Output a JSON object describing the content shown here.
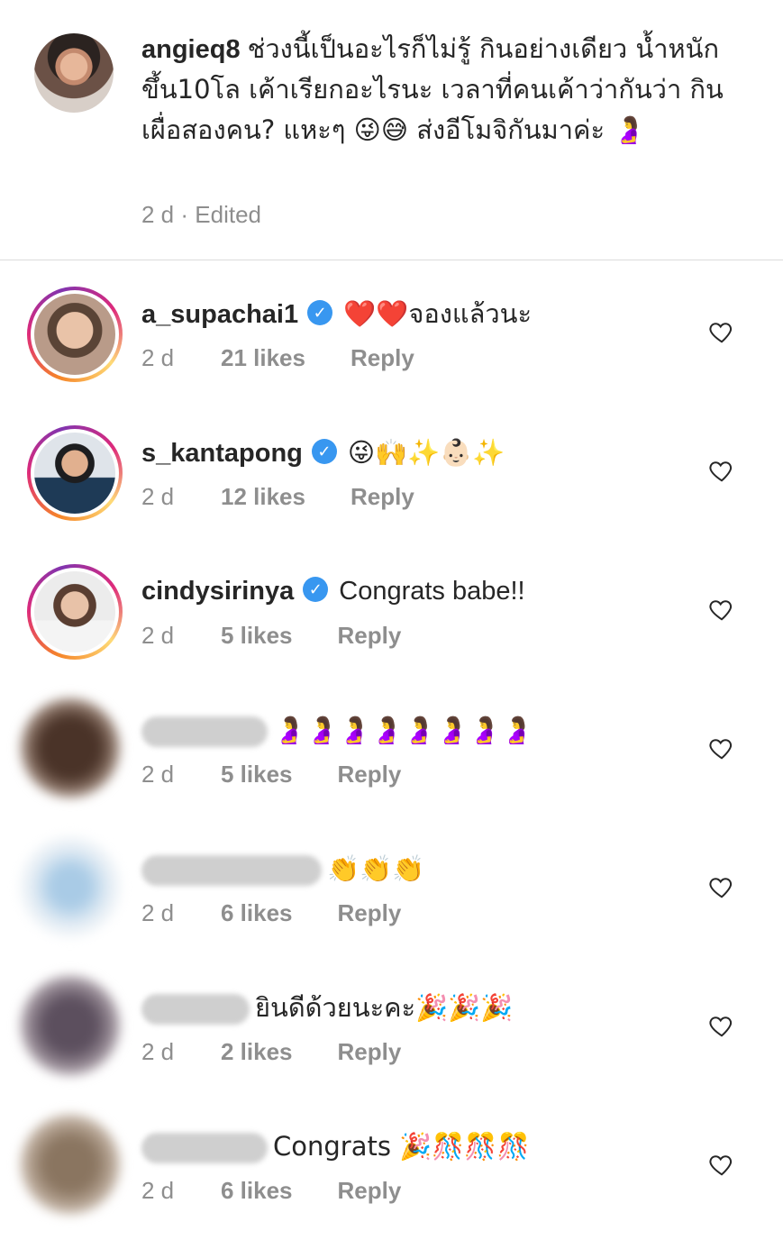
{
  "caption": {
    "username": "angieq8",
    "text": "ช่วงนี้เป็นอะไรก็ไม่รู้ กินอย่างเดียว น้ำหนักขึ้น10โล  เค้าเรียกอะไรนะ เวลาที่คนเค้าว่ากันว่า กินเผื่อสองคน? แหะๆ 😜😅 ส่งอีโมจิกันมาค่ะ 🤰",
    "time": "2 d",
    "edited": "· Edited"
  },
  "comments": [
    {
      "username": "a_supachai1",
      "verified": true,
      "text": "❤️❤️จองแล้วนะ",
      "time": "2 d",
      "likes": "21 likes",
      "reply": "Reply"
    },
    {
      "username": "s_kantapong",
      "verified": true,
      "text": "😜🙌✨👶🏻✨",
      "time": "2 d",
      "likes": "12 likes",
      "reply": "Reply"
    },
    {
      "username": "cindysirinya",
      "verified": true,
      "text": "Congrats babe!!",
      "time": "2 d",
      "likes": "5 likes",
      "reply": "Reply"
    },
    {
      "username": "",
      "verified": false,
      "text": "🤰🤰🤰🤰🤰🤰🤰🤰",
      "time": "2 d",
      "likes": "5 likes",
      "reply": "Reply"
    },
    {
      "username": "",
      "verified": false,
      "text": "👏👏👏",
      "time": "2 d",
      "likes": "6 likes",
      "reply": "Reply"
    },
    {
      "username": "",
      "verified": false,
      "text": "ยินดีด้วยนะคะ🎉🎉🎉",
      "time": "2 d",
      "likes": "2 likes",
      "reply": "Reply"
    },
    {
      "username": "",
      "verified": false,
      "text": "Congrats 🎉🎊🎊🎊",
      "time": "2 d",
      "likes": "6 likes",
      "reply": "Reply"
    }
  ],
  "icons": {
    "verified": "verified-badge-icon",
    "like": "heart-outline-icon"
  },
  "colors": {
    "link_blue": "#3897f0",
    "meta_gray": "#8e8e8e",
    "divider": "#dbdbdb"
  }
}
